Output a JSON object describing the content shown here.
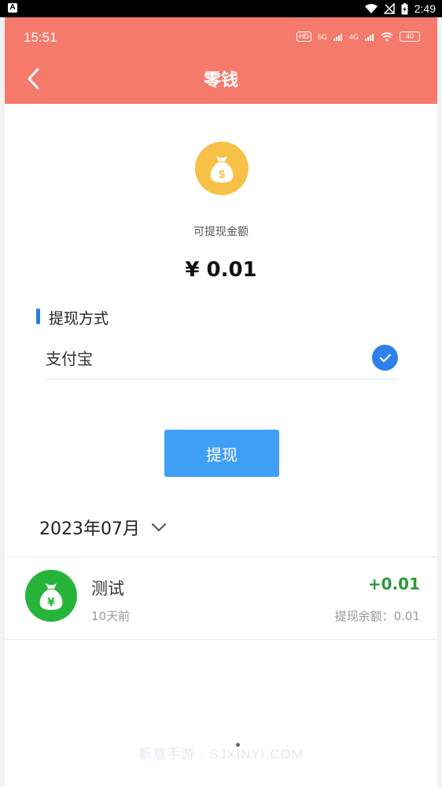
{
  "device_status": {
    "time": "2:49"
  },
  "status_bar": {
    "time": "15:51",
    "hd_badge": "HD",
    "signal1": "5G",
    "signal2": "4G",
    "battery": "40"
  },
  "header": {
    "title": "零钱"
  },
  "balance": {
    "label": "可提现金额",
    "amount": "¥ 0.01"
  },
  "withdraw_method": {
    "title": "提现方式",
    "selected": "支付宝"
  },
  "withdraw_button": {
    "label": "提现"
  },
  "month_filter": {
    "value": "2023年07月"
  },
  "records": [
    {
      "title": "测试",
      "time": "10天前",
      "amount": "+0.01",
      "balance_text": "提现余额：0.01"
    }
  ],
  "watermark": "新意手游 · SJXINYI.COM",
  "colors": {
    "header": "#f57a6b",
    "accent_blue": "#3f9ff7",
    "check_blue": "#2f80ed",
    "coin_gold": "#f7c147",
    "record_green": "#27b43b",
    "amount_green": "#2a9a3a"
  },
  "icons": [
    "back-arrow-icon",
    "money-bag-icon",
    "checkmark-icon",
    "chevron-down-icon",
    "yuan-bag-icon"
  ]
}
